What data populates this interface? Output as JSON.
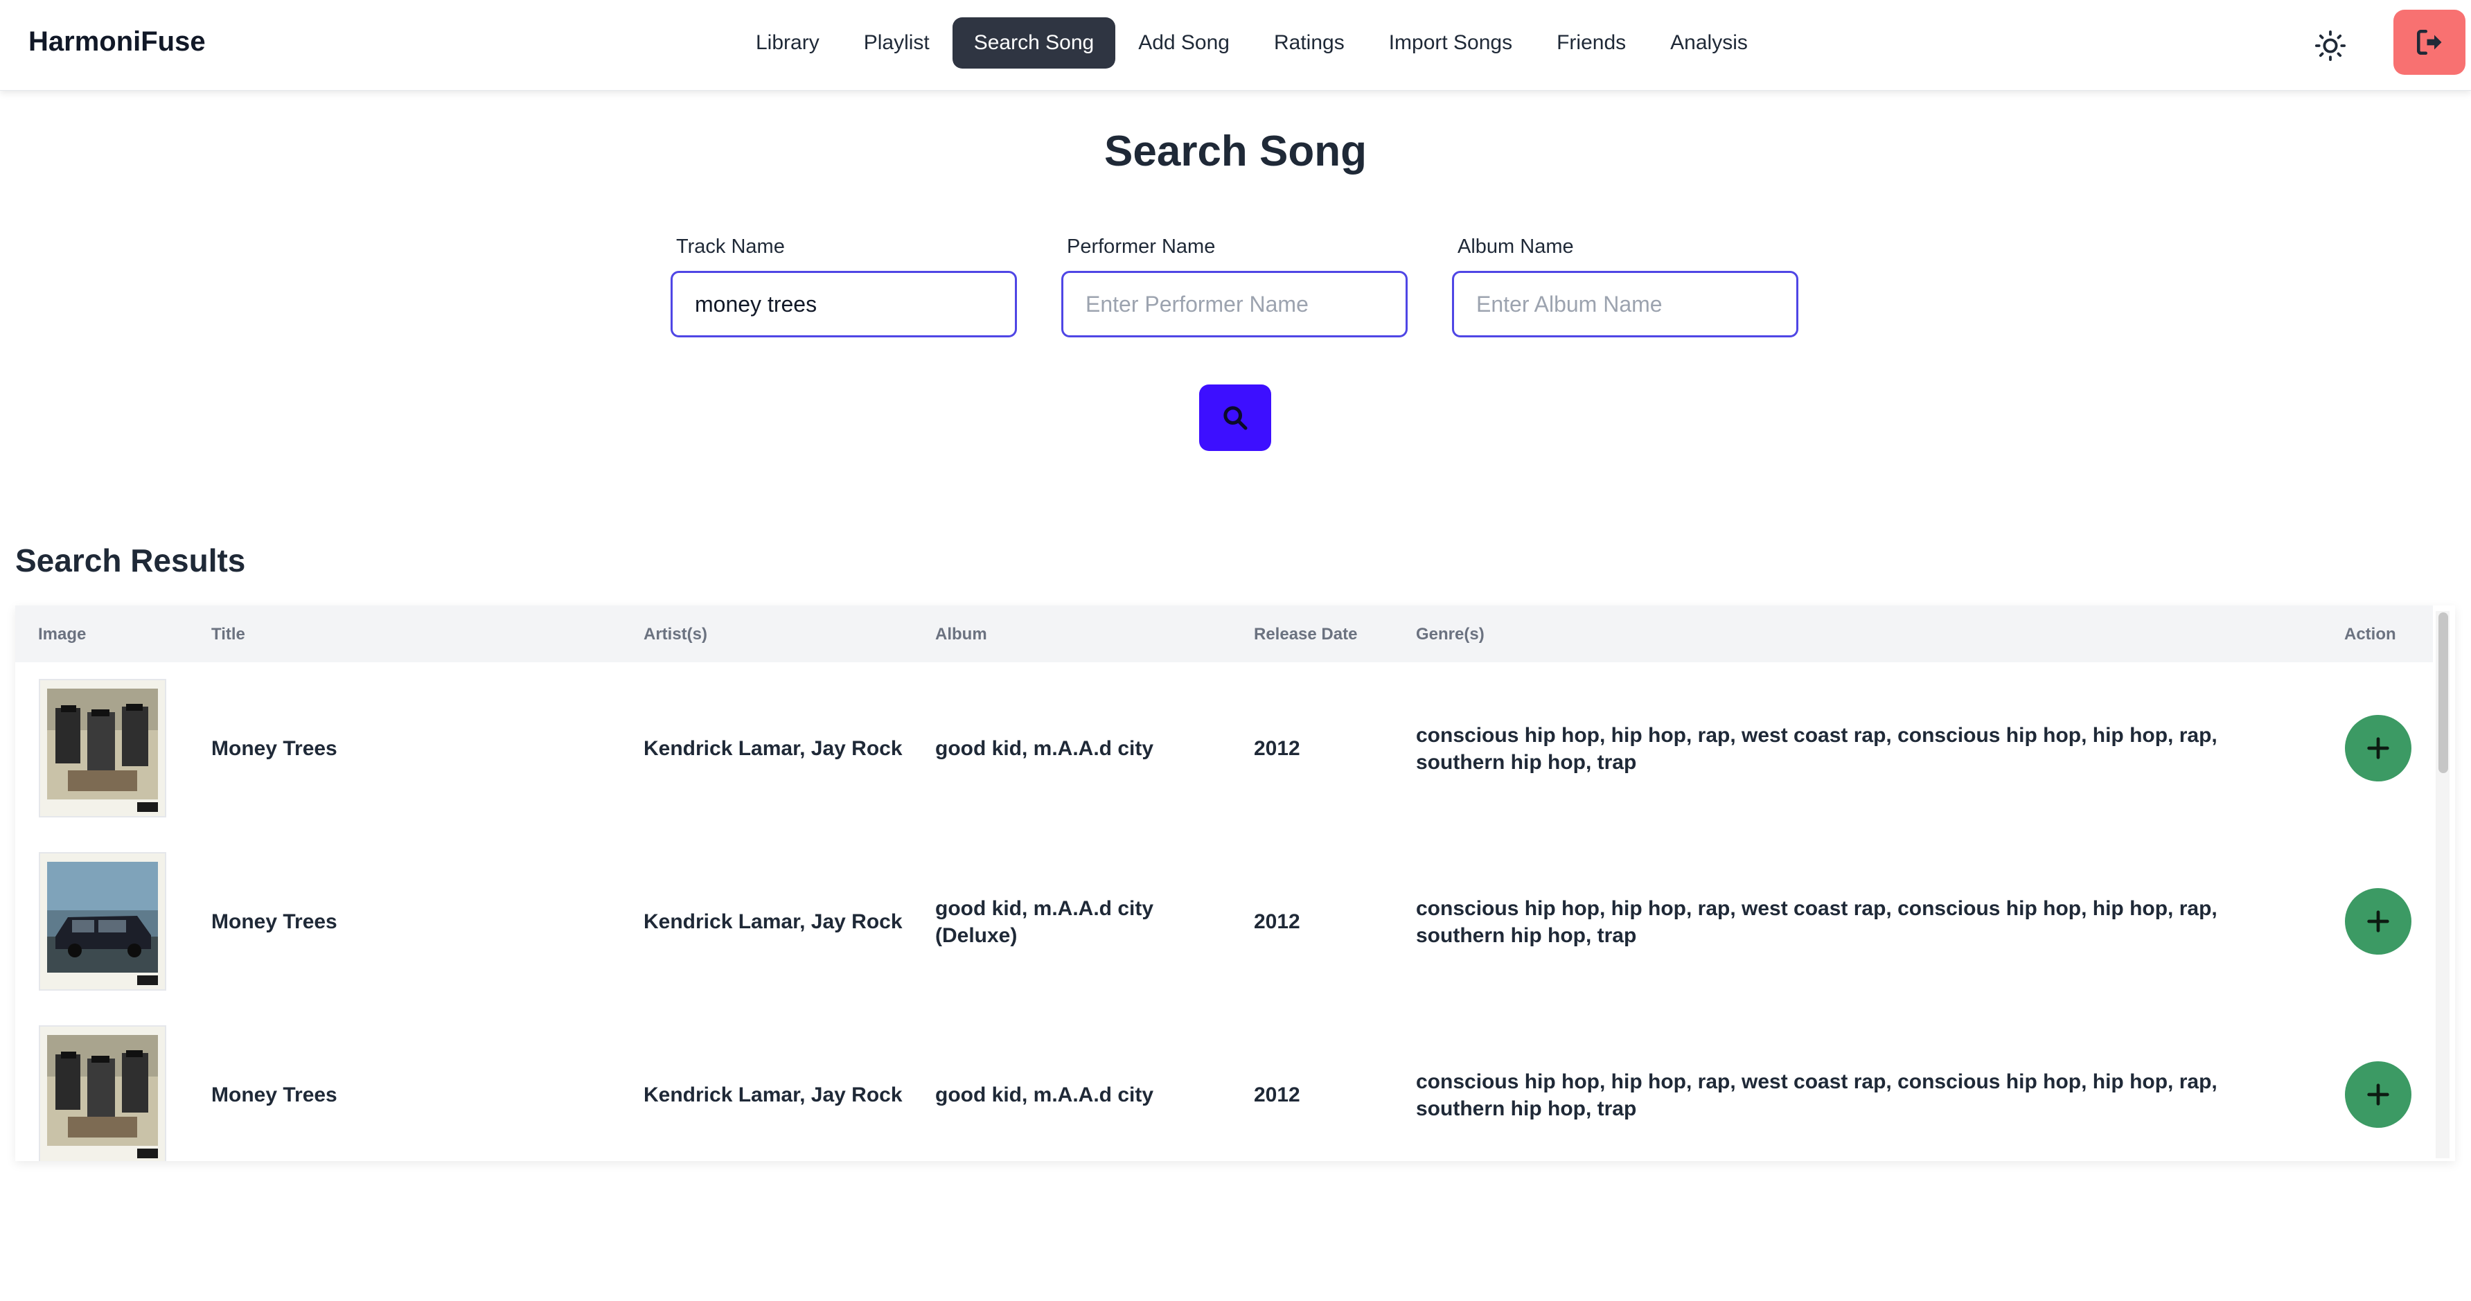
{
  "header": {
    "brand": "HarmoniFuse",
    "nav": [
      {
        "label": "Library"
      },
      {
        "label": "Playlist"
      },
      {
        "label": "Search Song"
      },
      {
        "label": "Add Song"
      },
      {
        "label": "Ratings"
      },
      {
        "label": "Import Songs"
      },
      {
        "label": "Friends"
      },
      {
        "label": "Analysis"
      }
    ],
    "active_tab": "Search Song",
    "theme_icon": "sun-icon",
    "logout_icon": "logout-icon"
  },
  "search": {
    "title": "Search Song",
    "fields": [
      {
        "label": "Track Name",
        "value": "money trees",
        "placeholder": ""
      },
      {
        "label": "Performer Name",
        "value": "",
        "placeholder": "Enter Performer Name"
      },
      {
        "label": "Album Name",
        "value": "",
        "placeholder": "Enter Album Name"
      }
    ],
    "button_icon": "search-icon"
  },
  "results": {
    "title": "Search Results",
    "columns": [
      "Image",
      "Title",
      "Artist(s)",
      "Album",
      "Release Date",
      "Genre(s)",
      "Action"
    ],
    "rows": [
      {
        "title": "Money Trees",
        "artists": "Kendrick Lamar, Jay Rock",
        "album": "good kid, m.A.A.d city",
        "release": "2012",
        "genres": "conscious hip hop, hip hop, rap, west coast rap, conscious hip hop, hip hop, rap, southern hip hop, trap",
        "cover": "family-photo"
      },
      {
        "title": "Money Trees",
        "artists": "Kendrick Lamar, Jay Rock",
        "album": "good kid, m.A.A.d city (Deluxe)",
        "release": "2012",
        "genres": "conscious hip hop, hip hop, rap, west coast rap, conscious hip hop, hip hop, rap, southern hip hop, trap",
        "cover": "van-photo"
      },
      {
        "title": "Money Trees",
        "artists": "Kendrick Lamar, Jay Rock",
        "album": "good kid, m.A.A.d city",
        "release": "2012",
        "genres": "conscious hip hop, hip hop, rap, west coast rap, conscious hip hop, hip hop, rap, southern hip hop, trap",
        "cover": "family-photo"
      }
    ]
  },
  "colors": {
    "accent": "#3d0fff",
    "input_border": "#4f46e5",
    "active_nav": "#2f3542",
    "logout": "#f87171",
    "add_button": "#3c9a64"
  }
}
